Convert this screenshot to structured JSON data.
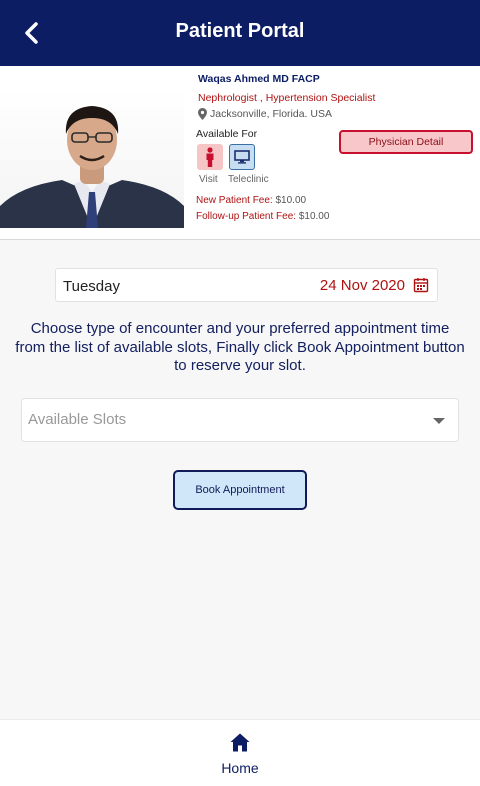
{
  "header": {
    "title": "Patient Portal",
    "back_icon": "chevron-left-icon"
  },
  "doctor": {
    "name": "Waqas Ahmed MD FACP",
    "specialty": "Nephrologist , Hypertension Specialist",
    "location": "Jacksonville, Florida. USA",
    "available_for_label": "Available For",
    "services": [
      {
        "label": "Visit",
        "icon": "person-icon"
      },
      {
        "label": "Teleclinic",
        "icon": "monitor-icon"
      }
    ],
    "new_fee_label": "New Patient Fee:",
    "new_fee_value": "$10.00",
    "followup_fee_label": "Follow-up Patient Fee:",
    "followup_fee_value": "$10.00",
    "detail_button": "Physician Detail"
  },
  "appointment": {
    "day": "Tuesday",
    "date": "24 Nov 2020",
    "instructions": "Choose type of encounter and your preferred appointment time from the list of available slots, Finally click Book  Appointment button to reserve your slot.",
    "slots_placeholder": "Available Slots",
    "book_button": "Book Appointment"
  },
  "bottom_nav": {
    "home_label": "Home"
  },
  "colors": {
    "primary": "#0d1d64",
    "accent_red": "#b01212",
    "button_bg": "#cfe7f8"
  }
}
